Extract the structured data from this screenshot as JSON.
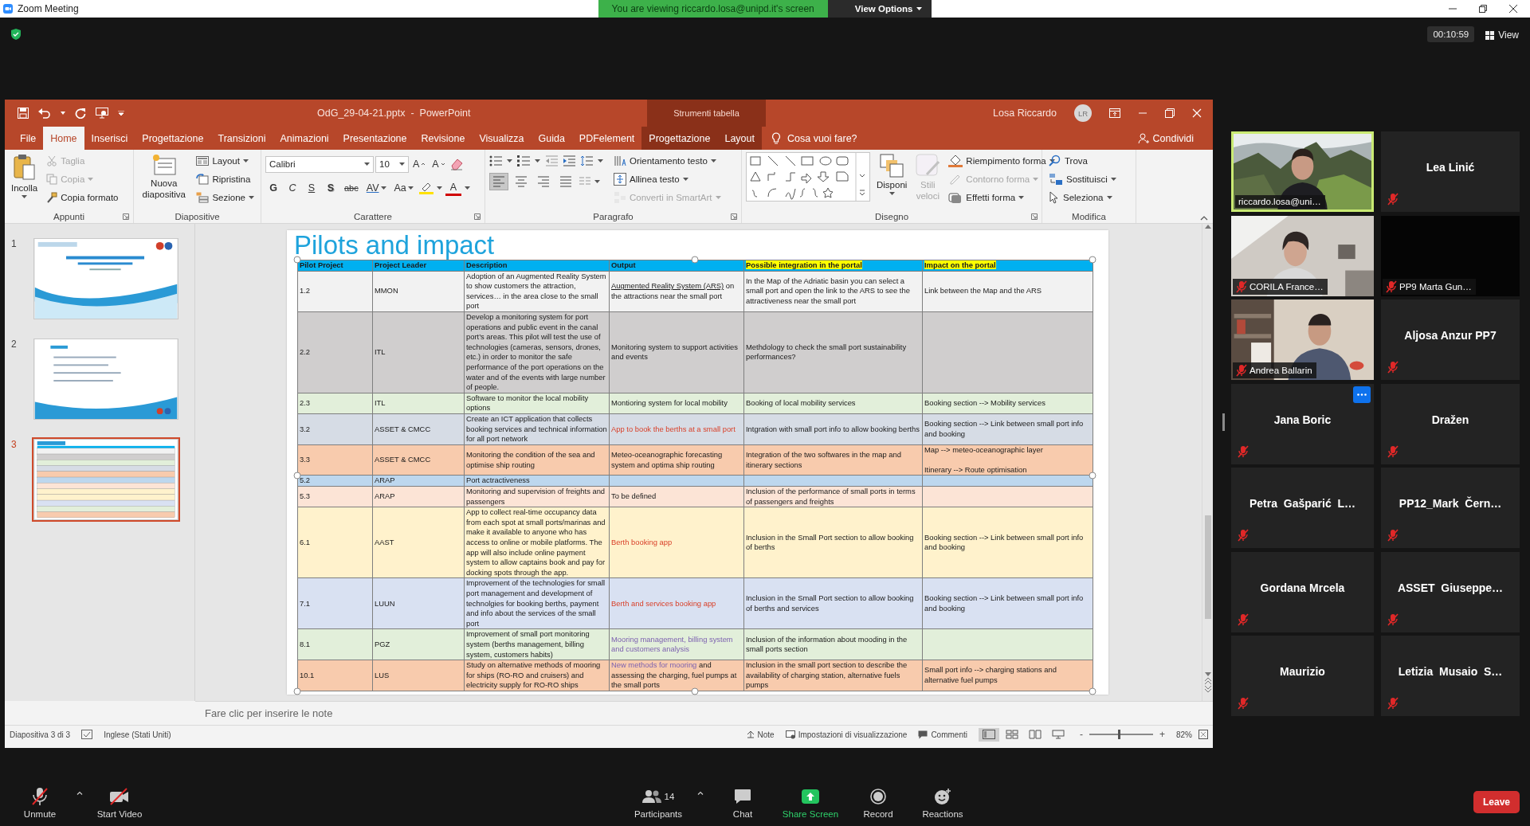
{
  "zoom_window": {
    "title": "Zoom Meeting"
  },
  "share_banner": {
    "text": "You are viewing riccardo.losa@unipd.it's screen",
    "view_options": "View Options"
  },
  "meeting": {
    "timer": "00:10:59",
    "view": "View"
  },
  "powerpoint": {
    "title": "OdG_29-04-21.pptx  -  PowerPoint",
    "context_label": "Strumenti tabella",
    "user": {
      "name": "Losa Riccardo",
      "initials": "LR"
    },
    "tabs": [
      {
        "label": "File",
        "selected": false,
        "contextual": false
      },
      {
        "label": "Home",
        "selected": true,
        "contextual": false
      },
      {
        "label": "Inserisci",
        "selected": false,
        "contextual": false
      },
      {
        "label": "Progettazione",
        "selected": false,
        "contextual": false
      },
      {
        "label": "Transizioni",
        "selected": false,
        "contextual": false
      },
      {
        "label": "Animazioni",
        "selected": false,
        "contextual": false
      },
      {
        "label": "Presentazione",
        "selected": false,
        "contextual": false
      },
      {
        "label": "Revisione",
        "selected": false,
        "contextual": false
      },
      {
        "label": "Visualizza",
        "selected": false,
        "contextual": false
      },
      {
        "label": "Guida",
        "selected": false,
        "contextual": false
      },
      {
        "label": "PDFelement",
        "selected": false,
        "contextual": false
      },
      {
        "label": "Progettazione",
        "selected": false,
        "contextual": true
      },
      {
        "label": "Layout",
        "selected": false,
        "contextual": true
      }
    ],
    "tell_me": "Cosa vuoi fare?",
    "share": "Condividi",
    "ribbon": {
      "clipboard": {
        "label": "Appunti",
        "paste": "Incolla",
        "items": [
          {
            "label": "Taglia",
            "disabled": true
          },
          {
            "label": "Copia",
            "disabled": true
          },
          {
            "label": "Copia formato",
            "disabled": false
          }
        ]
      },
      "slides": {
        "label": "Diapositive",
        "new_slide": "Nuova diapositiva",
        "items": [
          {
            "label": "Layout"
          },
          {
            "label": "Ripristina"
          },
          {
            "label": "Sezione"
          }
        ]
      },
      "font": {
        "label": "Carattere",
        "name": "Calibri",
        "size": "10",
        "sizers": [
          {
            "kind": "grow",
            "label": "A"
          },
          {
            "kind": "shrink",
            "label": "A"
          }
        ],
        "styles": [
          {
            "kind": "bold",
            "label": "G"
          },
          {
            "kind": "italic",
            "label": "C"
          },
          {
            "kind": "underline",
            "label": "S"
          },
          {
            "kind": "shadow",
            "label": "S"
          },
          {
            "kind": "strike",
            "label": "abc"
          },
          {
            "kind": "spacing",
            "label": "AV"
          },
          {
            "kind": "case",
            "label": "Aa"
          }
        ],
        "color_label": "A"
      },
      "paragraph": {
        "label": "Paragrafo",
        "alignments": [
          {
            "kind": "left",
            "selected": true
          },
          {
            "kind": "center",
            "selected": false
          },
          {
            "kind": "right",
            "selected": false
          },
          {
            "kind": "justify",
            "selected": false
          }
        ],
        "items": [
          {
            "label": "Orientamento testo",
            "disabled": false
          },
          {
            "label": "Allinea testo",
            "disabled": false
          },
          {
            "label": "Converti in SmartArt",
            "disabled": true
          }
        ]
      },
      "drawing": {
        "label": "Disegno",
        "arrange": "Disponi",
        "quick_styles": {
          "label": "Stili veloci",
          "disabled": true
        },
        "items": [
          {
            "label": "Riempimento forma",
            "disabled": false
          },
          {
            "label": "Contorno forma",
            "disabled": true
          },
          {
            "label": "Effetti forma",
            "disabled": false
          }
        ]
      },
      "editing": {
        "label": "Modifica",
        "items": [
          {
            "label": "Trova"
          },
          {
            "label": "Sostituisci"
          },
          {
            "label": "Seleziona"
          }
        ]
      }
    },
    "slides": [
      {
        "number": "1",
        "selected": false,
        "kind": "title"
      },
      {
        "number": "2",
        "selected": false,
        "kind": "agenda"
      },
      {
        "number": "3",
        "selected": true,
        "kind": "table"
      }
    ],
    "slide": {
      "title": "Pilots and impact",
      "table": {
        "columns": [
          {
            "label": "Pilot Project",
            "highlight": false
          },
          {
            "label": "Project Leader",
            "highlight": false
          },
          {
            "label": "Description",
            "highlight": false
          },
          {
            "label": "Output",
            "highlight": false
          },
          {
            "label": "Possible integration in the portal",
            "highlight": true
          },
          {
            "label": "Impact on the portal",
            "highlight": true
          }
        ],
        "rows": [
          {
            "pilot": "1.2",
            "leader": "MMON",
            "description": "Adoption of an Augmented Reality System to show customers the attraction, services… in the area close to the small port",
            "output": [
              {
                "text": "Augmented Reality System (ARS)",
                "kind": "underline"
              },
              {
                "text": "on the attractions near the small port",
                "kind": "plain"
              }
            ],
            "integration": "In the Map of the Adriatic basin you can select a small port and open the link to the ARS to see the attractiveness near the small port",
            "impact": "Link between the Map and the ARS",
            "color": "#f2f2f2"
          },
          {
            "pilot": "2.2",
            "leader": "ITL",
            "description": "Develop a monitoring system for port operations and public event in the canal port’s areas. This pilot will test the use of technologies (cameras, sensors, drones, etc.) in order to monitor the safe performance of the port operations on the water and of the events with large number of people.",
            "output": [
              {
                "text": "Monitoring system to support activities and events",
                "kind": "plain"
              }
            ],
            "integration": "Methdology to check the small port sustainability performances?",
            "color": "#d0cece"
          },
          {
            "pilot": "2.3",
            "leader": "ITL",
            "description": "Software to monitor the local mobility options",
            "output": [
              {
                "text": "Montioring system for local mobility",
                "kind": "plain"
              }
            ],
            "integration": "Booking of local mobility services",
            "impact": "Booking section --> Mobility services",
            "color": "#e2efda"
          },
          {
            "pilot": "3.2",
            "leader": "ASSET & CMCC",
            "description": "Create an ICT application that collects booking services and technical information for all port network",
            "output": [
              {
                "text": "App to book the berths at a small port",
                "kind": "red"
              }
            ],
            "integration": "Intgration with small port info to allow booking berths",
            "impact": "Booking section --> Link between small port info and booking",
            "color": "#d6dce5"
          },
          {
            "pilot": "3.3",
            "leader": "ASSET & CMCC",
            "description": "Monitoring the condition of the sea and optimise ship routing",
            "output": [
              {
                "text": "Meteo-oceanographic forecasting system and optima ship routing",
                "kind": "plain"
              }
            ],
            "integration": "Integration of the two softwares in the map and itinerary sections",
            "impact": "Map --> meteo-oceanographic layer\n\nItinerary --> Route optimisation",
            "color": "#f8cbad"
          },
          {
            "pilot": "5.2",
            "leader": "ARAP",
            "description": "Port actractiveness",
            "color": "#bdd7ee"
          },
          {
            "pilot": "5.3",
            "leader": "ARAP",
            "description": "Monitoring and supervision of freights and passengers",
            "output": [
              {
                "text": "To be defined",
                "kind": "plain"
              }
            ],
            "integration": "Inclusion of the performance of small ports in terms of passengers and freights",
            "color": "#fce4d6"
          },
          {
            "pilot": "6.1",
            "leader": "AAST",
            "description": "App to collect real-time occupancy data from each spot at small ports/marinas and make it available to anyone who has access to online or mobile platforms. The app will also include online payment system to allow captains book and pay for docking spots through the app.",
            "output": [
              {
                "text": "Berth booking app",
                "kind": "red"
              }
            ],
            "integration": "Inclusion in the Small Port section to allow booking of berths",
            "impact": "Booking section --> Link between small port info and booking",
            "color": "#fff2cc"
          },
          {
            "pilot": "7.1",
            "leader": "LUUN",
            "description": "Improvement of the technologies for small port management and development of technolgies for booking berths, payment and info about the services of the small port",
            "output": [
              {
                "text": "Berth and services booking app",
                "kind": "red"
              }
            ],
            "integration": "Inclusion in the Small Port section to allow booking of berths and services",
            "impact": "Booking section --> Link between small port info and booking",
            "color": "#d9e1f2"
          },
          {
            "pilot": "8.1",
            "leader": "PGZ",
            "description": "Improvement of small port monitoring system (berths management, billing system, customers habits)",
            "output": [
              {
                "text": "Mooring management, billing system and customers analysis",
                "kind": "purple"
              }
            ],
            "integration": "Inclusion of the information about mooding in the small ports section",
            "color": "#e2efda"
          },
          {
            "pilot": "10.1",
            "leader": "LUS",
            "description": "Study on alternative methods of mooring for ships (RO-RO and cruisers) and electricity supply for RO-RO ships",
            "output": [
              {
                "text": "New methods for mooring",
                "kind": "purple"
              },
              {
                "text": "and assessing the charging, fuel pumps at the small ports",
                "kind": "plain"
              }
            ],
            "integration": "Inclusion in the small port section to describe the availability of charging station, alternative fuels pumps",
            "impact": "Small port info --> charging stations and alternative fuel pumps",
            "color": "#f8cbad"
          }
        ]
      }
    },
    "notes": {
      "placeholder": "Fare clic per inserire le note"
    },
    "status_bar": {
      "slide_info": "Diapositiva 3 di 3",
      "language": "Inglese (Stati Uniti)",
      "notes": "Note",
      "view_settings": "Impostazioni di visualizzazione",
      "comments": "Commenti",
      "views": [
        {
          "kind": "normal",
          "selected": true
        },
        {
          "kind": "sorter",
          "selected": false
        },
        {
          "kind": "reading",
          "selected": false
        },
        {
          "kind": "slideshow",
          "selected": false
        }
      ],
      "zoom_out": "-",
      "zoom_in": "+",
      "zoom": {
        "level": 0.45
      },
      "zoom_percent": "82%"
    }
  },
  "participants": [
    {
      "name": "riccardo.losa@uni…",
      "kind": "video",
      "muted": false,
      "active": true,
      "hover": false
    },
    {
      "name": "Lea Linić",
      "kind": "name",
      "muted": true,
      "active": false,
      "hover": false
    },
    {
      "name": "CORILA France…",
      "kind": "video",
      "muted": true,
      "active": false,
      "hover": false
    },
    {
      "name": "PP9 Marta Gun…",
      "kind": "dark",
      "muted": true,
      "active": false,
      "hover": false
    },
    {
      "name": "Andrea Ballarin",
      "kind": "video",
      "muted": true,
      "active": false,
      "hover": false
    },
    {
      "name": "Aljosa Anzur PP7",
      "kind": "name",
      "muted": true,
      "active": false,
      "hover": false
    },
    {
      "name": "Jana Boric",
      "kind": "name",
      "muted": true,
      "active": false,
      "hover": true
    },
    {
      "name": "Dražen",
      "kind": "name",
      "muted": true,
      "active": false,
      "hover": false
    },
    {
      "name": "Petra  Gašparić  L…",
      "kind": "name",
      "muted": true,
      "active": false,
      "hover": false
    },
    {
      "name": "PP12_Mark  Čern…",
      "kind": "name",
      "muted": true,
      "active": false,
      "hover": false
    },
    {
      "name": "Gordana Mrcela",
      "kind": "name",
      "muted": true,
      "active": false,
      "hover": false
    },
    {
      "name": "ASSET  Giuseppe…",
      "kind": "name",
      "muted": true,
      "active": false,
      "hover": false
    },
    {
      "name": "Maurizio",
      "kind": "name",
      "muted": true,
      "active": false,
      "hover": false
    },
    {
      "name": "Letizia  Musaio  S…",
      "kind": "name",
      "muted": true,
      "active": false,
      "hover": false
    }
  ],
  "toolbar": {
    "left": [
      {
        "kind": "mic",
        "label": "Unmute",
        "caret": true
      },
      {
        "kind": "camera",
        "label": "Start Video",
        "caret": false
      }
    ],
    "center": [
      {
        "kind": "participants",
        "label": "Participants",
        "count": "14",
        "caret": true
      },
      {
        "kind": "chat",
        "label": "Chat",
        "caret": false
      },
      {
        "kind": "share",
        "label": "Share Screen",
        "caret": false
      },
      {
        "kind": "record",
        "label": "Record",
        "caret": false
      },
      {
        "kind": "reactions",
        "label": "Reactions",
        "caret": false
      }
    ],
    "leave": "Leave"
  }
}
